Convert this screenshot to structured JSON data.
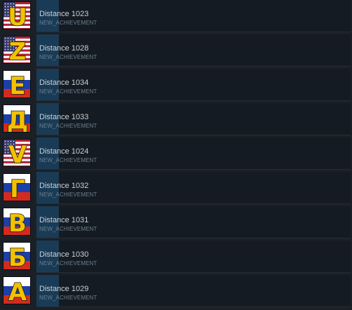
{
  "achievements": [
    {
      "title": "Distance 1023",
      "subtitle": "NEW_ACHIEVEMENT",
      "letter": "U",
      "flag": "us"
    },
    {
      "title": "Distance 1028",
      "subtitle": "NEW_ACHIEVEMENT",
      "letter": "Z",
      "flag": "us"
    },
    {
      "title": "Distance 1034",
      "subtitle": "NEW_ACHIEVEMENT",
      "letter": "Е",
      "flag": "ru"
    },
    {
      "title": "Distance 1033",
      "subtitle": "NEW_ACHIEVEMENT",
      "letter": "Д",
      "flag": "ru"
    },
    {
      "title": "Distance 1024",
      "subtitle": "NEW_ACHIEVEMENT",
      "letter": "V",
      "flag": "us"
    },
    {
      "title": "Distance 1032",
      "subtitle": "NEW_ACHIEVEMENT",
      "letter": "Г",
      "flag": "ru"
    },
    {
      "title": "Distance 1031",
      "subtitle": "NEW_ACHIEVEMENT",
      "letter": "В",
      "flag": "ru"
    },
    {
      "title": "Distance 1030",
      "subtitle": "NEW_ACHIEVEMENT",
      "letter": "Б",
      "flag": "ru"
    },
    {
      "title": "Distance 1029",
      "subtitle": "NEW_ACHIEVEMENT",
      "letter": "А",
      "flag": "ru"
    }
  ],
  "colors": {
    "background": "#1b2026",
    "panel": "#141b22",
    "accent": "#1a3b55",
    "letter_fill": "#f2c200",
    "letter_stroke": "#1a1a1a"
  }
}
